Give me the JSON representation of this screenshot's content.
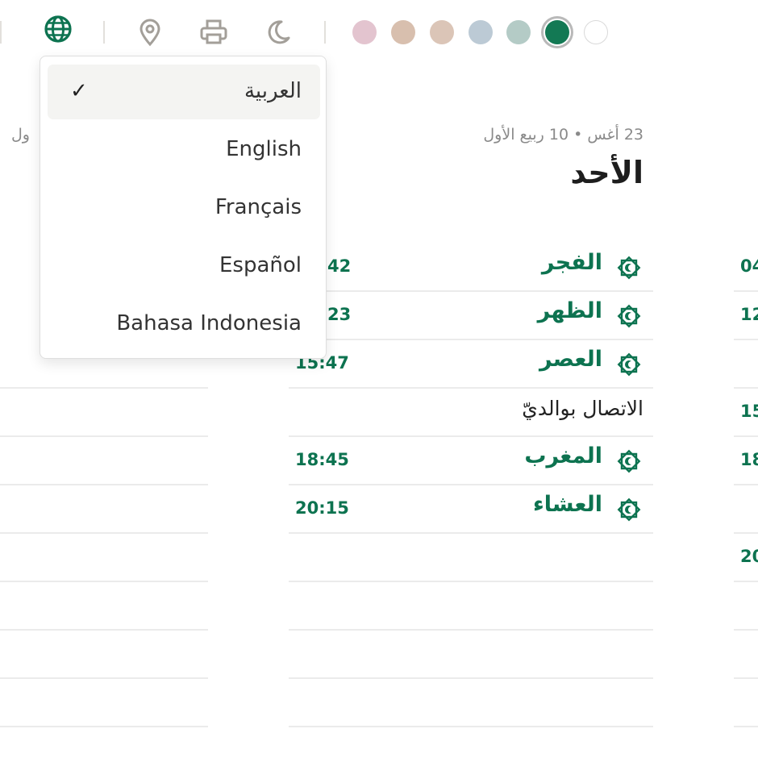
{
  "toolbar": {
    "icons": [
      "globe-icon",
      "location-pin-icon",
      "printer-icon",
      "moon-icon"
    ],
    "swatches": [
      "#e3c4cf",
      "#d8bfae",
      "#dbc5b7",
      "#bccad5",
      "#b4cbc6",
      "#137954",
      "#ffffff"
    ],
    "selected_swatch": 5
  },
  "language_menu": {
    "items": [
      {
        "label": "العربية",
        "selected": true
      },
      {
        "label": "English",
        "selected": false
      },
      {
        "label": "Français",
        "selected": false
      },
      {
        "label": "Español",
        "selected": false
      },
      {
        "label": "Bahasa Indonesia",
        "selected": false
      }
    ],
    "check_mark": "✓"
  },
  "left_column": {
    "date_fragment": "ول"
  },
  "center_column": {
    "date_line": "23 أغس • 10 ربيع الأول",
    "day_name": "الأحد",
    "prayers": [
      {
        "name": "الفجر",
        "time": "42"
      },
      {
        "name": "الظهر",
        "time": "23"
      },
      {
        "name": "العصر",
        "time": "15:47"
      },
      {
        "name": "المغرب",
        "time": "18:45"
      },
      {
        "name": "العشاء",
        "time": "20:15"
      }
    ],
    "event": "الاتصال بوالديّ"
  },
  "right_column": {
    "times": [
      "04",
      "12",
      "15",
      "18",
      "20"
    ]
  },
  "colors": {
    "accent": "#0d7350",
    "text": "#1d1d1d",
    "muted": "#8a8a8a"
  }
}
